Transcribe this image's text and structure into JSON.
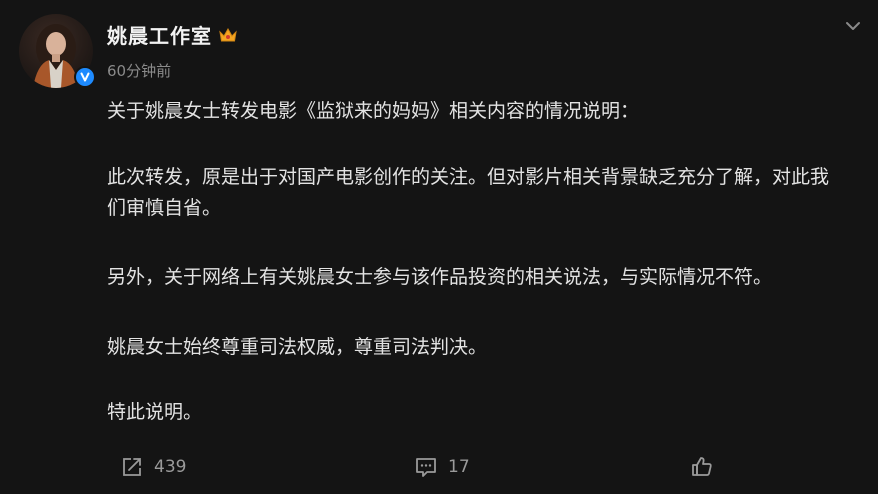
{
  "post": {
    "author": "姚晨工作室",
    "time": "60分钟前",
    "paragraphs": [
      "关于姚晨女士转发电影《监狱来的妈妈》相关内容的情况说明：",
      "此次转发，原是出于对国产电影创作的关注。但对影片相关背景缺乏充分了解，对此我们审慎自省。",
      "另外，关于网络上有关姚晨女士参与该作品投资的相关说法，与实际情况不符。",
      "姚晨女士始终尊重司法权威，尊重司法判决。",
      "特此说明。"
    ]
  },
  "actions": {
    "share_count": "439",
    "comment_count": "17",
    "like_count": ""
  },
  "colors": {
    "background": "#141414",
    "text": "#e3e3e3",
    "muted": "#8a8a8a",
    "verified": "#1e8bff",
    "crown": "#f5a623"
  },
  "icons": [
    "crown-icon",
    "verified-icon",
    "chevron-down-icon",
    "share-icon",
    "comment-icon",
    "like-icon"
  ]
}
